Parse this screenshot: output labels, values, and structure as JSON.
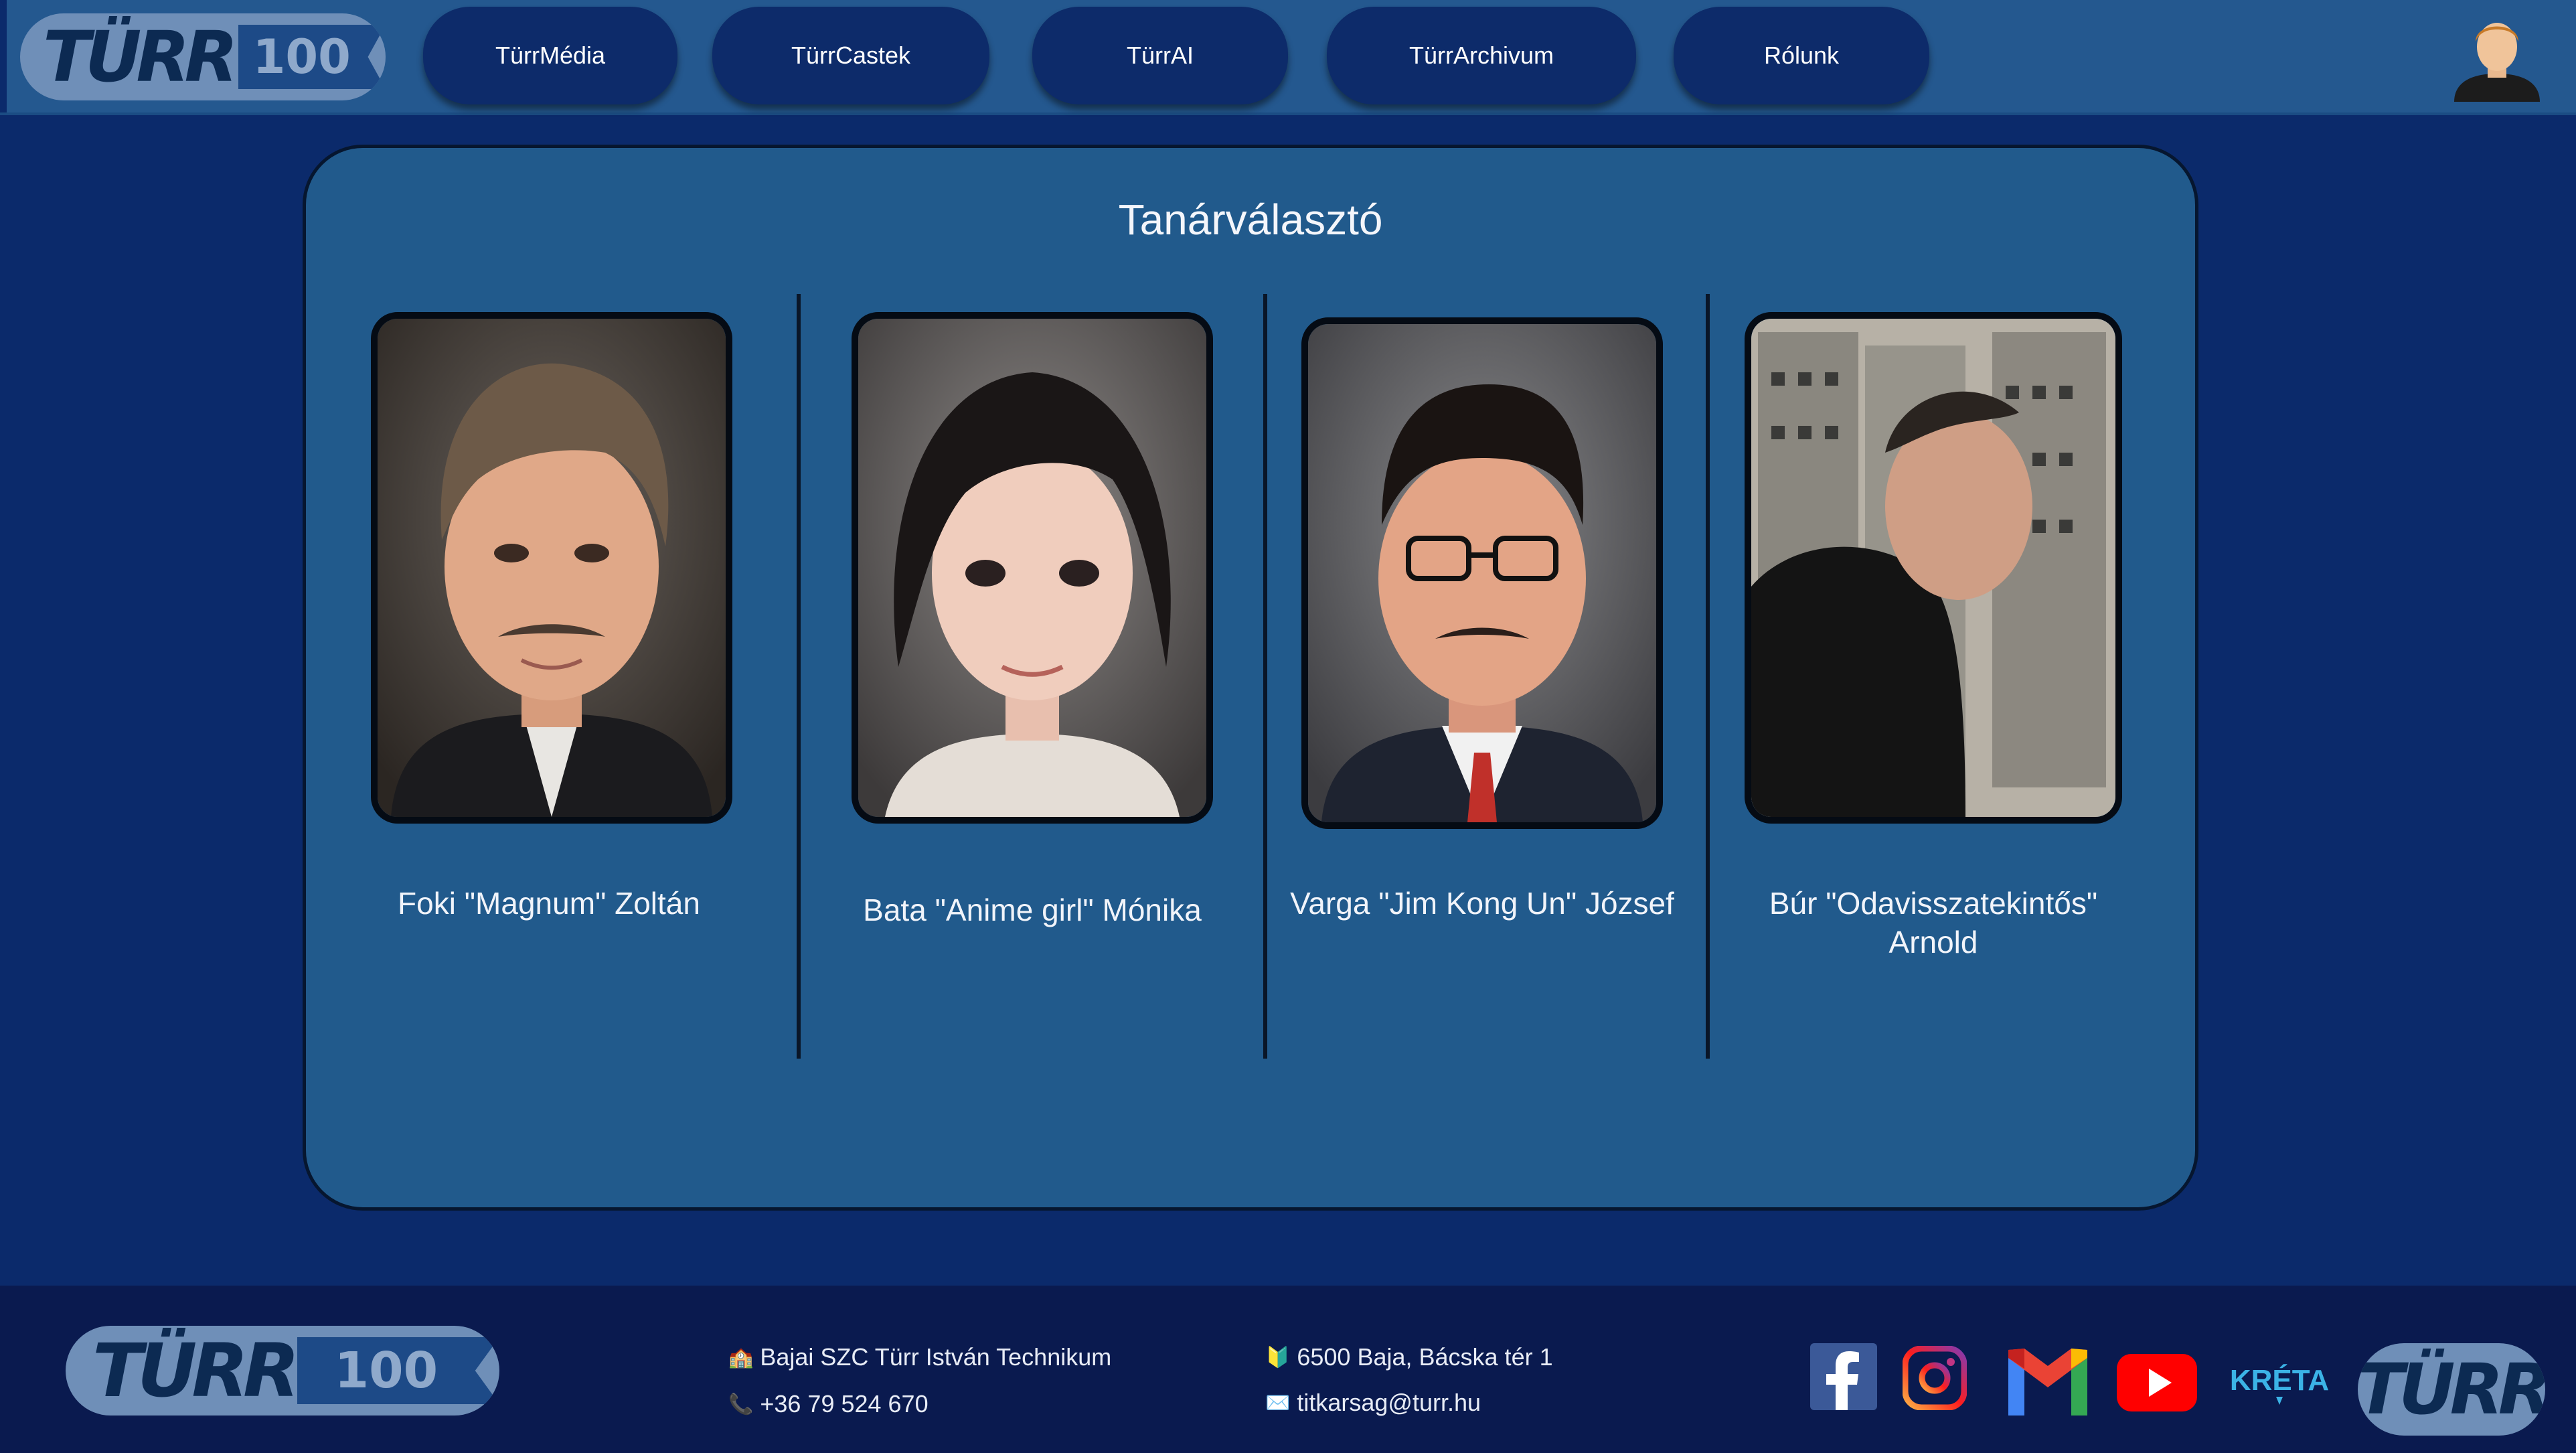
{
  "header": {
    "logo": {
      "word": "TÜRR",
      "number": "100"
    },
    "nav": [
      {
        "label": "TürrMédia"
      },
      {
        "label": "TürrCastek"
      },
      {
        "label": "TürrAI"
      },
      {
        "label": "TürrArchivum"
      },
      {
        "label": "Rólunk"
      }
    ],
    "user_icon": "user-avatar-icon"
  },
  "main": {
    "title": "Tanárválasztó",
    "teachers": [
      {
        "name": "Foki \"Magnum\" Zoltán",
        "photo_icon": "portrait-man-mustache"
      },
      {
        "name": "Bata \"Anime girl\" Mónika",
        "photo_icon": "portrait-woman-anime"
      },
      {
        "name": "Varga \"Jim Kong Un\" József",
        "photo_icon": "portrait-man-glasses"
      },
      {
        "name": "Búr \"Odavisszatekintős\" Arnold",
        "photo_icon": "photo-man-server-room"
      }
    ]
  },
  "footer": {
    "logo": {
      "word": "TÜRR",
      "number": "100"
    },
    "school": "Bajai SZC Türr István Technikum",
    "phone": "+36 79 524 670",
    "address": "6500 Baja, Bácska tér 1",
    "email": "titkarsag@turr.hu",
    "kreta_label": "KRÉTA",
    "logo_small": "TÜRR",
    "social_icons": [
      "facebook-icon",
      "instagram-icon",
      "gmail-icon",
      "youtube-icon",
      "kreta-icon"
    ]
  },
  "colors": {
    "page_bg": "#0b2a6b",
    "header_bg": "#24588f",
    "nav_button": "#0d2b6a",
    "card_bg": "#215a8c",
    "footer_bg": "#0a1a4f"
  }
}
